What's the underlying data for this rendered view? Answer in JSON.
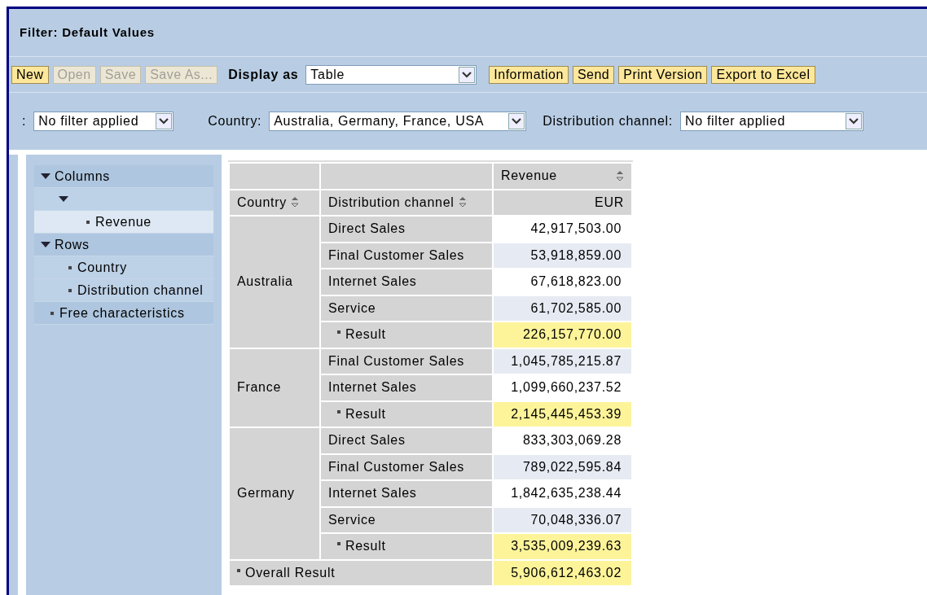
{
  "title": "Filter: Default Values",
  "toolbar": [
    {
      "kind": "button",
      "label": "New",
      "disabled": false
    },
    {
      "kind": "button",
      "label": "Open",
      "disabled": true
    },
    {
      "kind": "button",
      "label": "Save",
      "disabled": true
    },
    {
      "kind": "button",
      "label": "Save As...",
      "disabled": true
    },
    {
      "kind": "select",
      "label": "Display as",
      "value": "Table"
    },
    {
      "kind": "button",
      "label": "Information",
      "disabled": false
    },
    {
      "kind": "button",
      "label": "Send",
      "disabled": false
    },
    {
      "kind": "button",
      "label": "Print Version",
      "disabled": false
    },
    {
      "kind": "button",
      "label": "Export to Excel",
      "disabled": false
    }
  ],
  "filters": [
    {
      "label": ":",
      "value": "No filter applied"
    },
    {
      "label": "Country:",
      "value": "Australia, Germany, France, USA"
    },
    {
      "label": "Distribution channel:",
      "value": "No filter applied"
    }
  ],
  "navigation": [
    {
      "label": "Columns",
      "expanded": true,
      "children": [
        {
          "expanded": true,
          "children": [
            {
              "label": "Revenue",
              "selected": true
            }
          ]
        }
      ]
    },
    {
      "label": "Rows",
      "expanded": true,
      "children": [
        {
          "label": "Country",
          "selected": false
        },
        {
          "label": "Distribution channel",
          "selected": false
        }
      ]
    },
    {
      "label": "Free characteristics",
      "selected": false
    }
  ],
  "table": {
    "columns": [
      "Country",
      "Distribution channel"
    ],
    "measure": "Revenue",
    "unit": "EUR",
    "groups": [
      {
        "country": "Australia",
        "rows": [
          {
            "kind": "data",
            "channel": "Direct Sales",
            "value": "42,917,503.00"
          },
          {
            "kind": "data",
            "channel": "Final Customer Sales",
            "value": "53,918,859.00"
          },
          {
            "kind": "data",
            "channel": "Internet Sales",
            "value": "67,618,823.00"
          },
          {
            "kind": "data",
            "channel": "Service",
            "value": "61,702,585.00"
          },
          {
            "kind": "result",
            "channel": "Result",
            "value": "226,157,770.00"
          }
        ]
      },
      {
        "country": "France",
        "rows": [
          {
            "kind": "data",
            "channel": "Final Customer Sales",
            "value": "1,045,785,215.87"
          },
          {
            "kind": "data",
            "channel": "Internet Sales",
            "value": "1,099,660,237.52"
          },
          {
            "kind": "result",
            "channel": "Result",
            "value": "2,145,445,453.39"
          }
        ]
      },
      {
        "country": "Germany",
        "rows": [
          {
            "kind": "data",
            "channel": "Direct Sales",
            "value": "833,303,069.28"
          },
          {
            "kind": "data",
            "channel": "Final Customer Sales",
            "value": "789,022,595.84"
          },
          {
            "kind": "data",
            "channel": "Internet Sales",
            "value": "1,842,635,238.44"
          },
          {
            "kind": "data",
            "channel": "Service",
            "value": "70,048,336.07"
          },
          {
            "kind": "result",
            "channel": "Result",
            "value": "3,535,009,239.63"
          }
        ]
      }
    ],
    "overall": {
      "label": "Overall Result",
      "value": "5,906,612,463.02"
    }
  }
}
